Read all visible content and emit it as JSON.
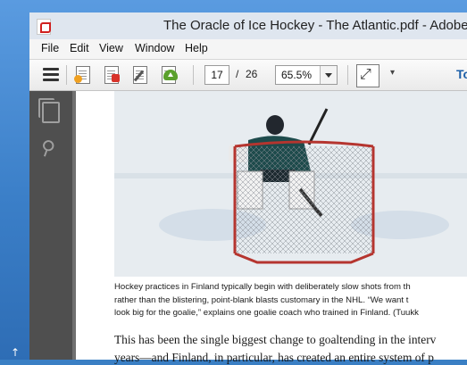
{
  "window": {
    "title": "The Oracle of Ice Hockey - The Atlantic.pdf - Adobe"
  },
  "menu": {
    "items": [
      "File",
      "Edit",
      "View",
      "Window",
      "Help"
    ]
  },
  "toolbar": {
    "current_page": "17",
    "page_separator": "/",
    "total_pages": "26",
    "zoom": "65.5%",
    "more_arrow": "▾",
    "tools_label": "To",
    "icons": [
      "menu-icon",
      "create-pdf-icon",
      "export-pdf-icon",
      "sign-icon",
      "upload-icon",
      "fit-page-icon"
    ]
  },
  "sidebar": {
    "icons": [
      "pages-icon",
      "attachment-icon"
    ]
  },
  "document": {
    "caption_lines": [
      "Hockey practices in Finland typically begin with deliberately slow shots from th",
      "rather than the blistering, point-blank blasts customary in the NHL. “We want t",
      "look big for the goalie,” explains one goalie coach who trained in Finland. (Tuukk"
    ],
    "body_lines": [
      "This has been the single biggest change to goaltending in the interv",
      "years—and Finland, in particular, has created an entire system of p"
    ]
  },
  "colors": {
    "accent": "#1c5fa8",
    "sidebar_bg": "#4f4f4f",
    "doc_bg": "#707070"
  }
}
